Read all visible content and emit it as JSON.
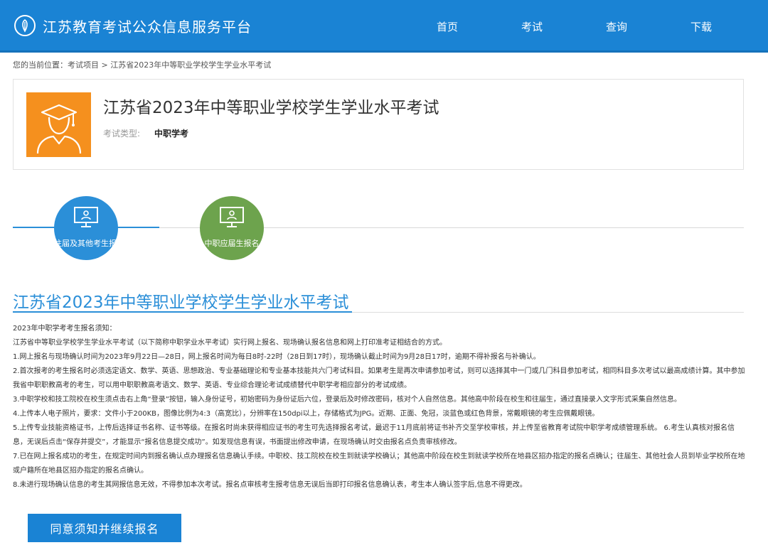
{
  "header": {
    "site_title": "江苏教育考试公众信息服务平台",
    "nav": [
      "首页",
      "考试",
      "查询",
      "下载"
    ]
  },
  "breadcrumb": {
    "prefix": "您的当前位置：",
    "items": [
      "考试项目",
      "江苏省2023年中等职业学校学生学业水平考试"
    ],
    "separator": " > "
  },
  "exam": {
    "title": "江苏省2023年中等职业学校学生学业水平考试",
    "type_label": "考试类型:",
    "type_value": "中职学考",
    "avatar_icon": "graduate-icon",
    "avatar_color": "#f5901e"
  },
  "tabs": [
    {
      "label": "往届及其他考生报名",
      "icon": "monitor-icon",
      "color": "#2b8fd8",
      "active": true
    },
    {
      "label": "中职应届生报名",
      "icon": "monitor-icon",
      "color": "#6da34d",
      "active": false
    }
  ],
  "notice": {
    "title": "江苏省2023年中等职业学校学生学业水平考试",
    "lines": [
      "2023年中职学考考生报名须知：",
      "江苏省中等职业学校学生学业水平考试（以下简称中职学业水平考试）实行网上报名、现场确认报名信息和网上打印准考证相结合的方式。",
      "1.网上报名与现场确认时间为2023年9月22日—28日，网上报名时间为每日8时-22时（28日到17时），现场确认截止时间为9月28日17时，逾期不得补报名与补确认。",
      "2.首次报考的考生报名时必须选定语文、数学、英语、思想政治、专业基础理论和专业基本技能共六门考试科目。如果考生是再次申请参加考试，则可以选择其中一门或几门科目参加考试，相同科目多次考试以最高成绩计算。其中参加我省中职职教高考的考生，可以用中职职教高考语文、数学、英语、专业综合理论考试成绩替代中职学考相应部分的考试成绩。",
      "3.中职学校和技工院校在校生须点击右上角“登录”按钮，输入身份证号，初始密码为身份证后六位，登录后及时修改密码，核对个人自然信息。其他高中阶段在校生和往届生，通过直接录入文字形式采集自然信息。",
      "4.上传本人电子照片，要求：文件小于200KB，图像比例为4:3（高宽比），分辨率在150dpi以上，存储格式为JPG。近期、正面、免冠，淡蓝色或红色背景，常戴眼镜的考生应佩戴眼镜。",
      "5.上传专业技能资格证书，上传后选择证书名称、证书等级。在报名时尚未获得相应证书的考生可先选择报名考试，最迟于11月底前将证书补齐交至学校审核，并上传至省教育考试院中职学考成绩管理系统。 6.考生认真核对报名信息，无误后点击“保存并提交”，才能显示“报名信息提交成功”。如发现信息有误，书面提出修改申请，在现场确认时交由报名点负责审核修改。",
      "7.已在网上报名成功的考生，在规定时间内到报名确认点办理报名信息确认手续。中职校、技工院校在校生到就读学校确认；其他高中阶段在校生到就读学校所在地县区招办指定的报名点确认；往届生、其他社会人员到毕业学校所在地或户籍所在地县区招办指定的报名点确认。",
      "8.未进行现场确认信息的考生其网报信息无效，不得参加本次考试。报名点审核考生报考信息无误后当即打印报名信息确认表，考生本人确认签字后,信息不得更改。"
    ]
  },
  "actions": {
    "continue_label": "同意须知并继续报名"
  }
}
